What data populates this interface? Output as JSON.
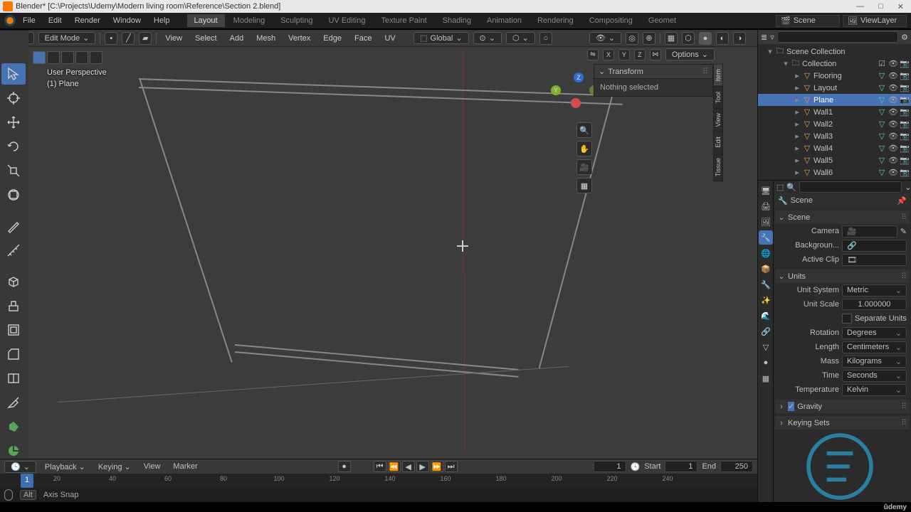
{
  "title": "Blender* [C:\\Projects\\Udemy\\Modern living room\\Reference\\Section 2.blend]",
  "topmenu": [
    "File",
    "Edit",
    "Render",
    "Window",
    "Help"
  ],
  "workspaces": [
    "Layout",
    "Modeling",
    "Sculpting",
    "UV Editing",
    "Texture Paint",
    "Shading",
    "Animation",
    "Rendering",
    "Compositing",
    "Geomet"
  ],
  "active_workspace": "Layout",
  "scene_label": "Scene",
  "viewlayer_label": "ViewLayer",
  "editor": {
    "mode": "Edit Mode",
    "menus": [
      "View",
      "Select",
      "Add",
      "Mesh",
      "Vertex",
      "Edge",
      "Face",
      "UV"
    ],
    "orientation": "Global"
  },
  "viewport": {
    "persp": "User Perspective",
    "obj": "(1) Plane",
    "options_label": "Options",
    "transform_panel": "Transform",
    "transform_status": "Nothing selected",
    "axes": [
      "X",
      "Y",
      "Z"
    ],
    "ntabs": [
      "Item",
      "Tool",
      "View",
      "Edit",
      "Tissue"
    ]
  },
  "outliner": {
    "root": "Scene Collection",
    "collection": "Collection",
    "items": [
      "Flooring",
      "Layout",
      "Plane",
      "Wall1",
      "Wall2",
      "Wall3",
      "Wall4",
      "Wall5",
      "Wall6"
    ],
    "selected_index": 2
  },
  "properties": {
    "scene": "Scene",
    "panels": {
      "scene_panel": "Scene",
      "camera": "Camera",
      "background": "Backgroun...",
      "activeclip": "Active Clip",
      "units": "Units",
      "unit_system_label": "Unit System",
      "unit_system": "Metric",
      "unit_scale_label": "Unit Scale",
      "unit_scale": "1.000000",
      "separate_units": "Separate Units",
      "rotation_label": "Rotation",
      "rotation": "Degrees",
      "length_label": "Length",
      "length": "Centimeters",
      "mass_label": "Mass",
      "mass": "Kilograms",
      "time_label": "Time",
      "time": "Seconds",
      "temperature_label": "Temperature",
      "temperature": "Kelvin",
      "gravity": "Gravity",
      "keying_sets": "Keying Sets"
    }
  },
  "timeline": {
    "menus": [
      "Playback",
      "Keying",
      "View",
      "Marker"
    ],
    "current": "1",
    "start_label": "Start",
    "start": "1",
    "end_label": "End",
    "end": "250",
    "ticks": [
      "20",
      "40",
      "60",
      "80",
      "100",
      "120",
      "140",
      "160",
      "180",
      "200",
      "220",
      "240"
    ]
  },
  "status": {
    "hint": "Axis Snap",
    "key": "Alt"
  },
  "udemy": "ûdemy"
}
